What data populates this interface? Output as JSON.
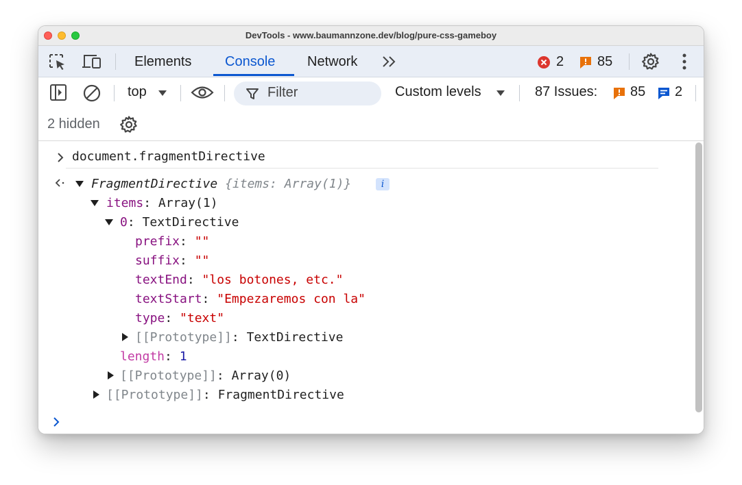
{
  "window": {
    "title": "DevTools - www.baumannzone.dev/blog/pure-css-gameboy"
  },
  "tabs": {
    "elements": "Elements",
    "console": "Console",
    "network": "Network"
  },
  "header_counts": {
    "errors": "2",
    "warnings": "85"
  },
  "toolbar": {
    "context": "top",
    "filter_placeholder": "Filter",
    "levels": "Custom levels",
    "issues_label": "87 Issues:",
    "issues_warnings": "85",
    "issues_info": "2",
    "hidden": "2 hidden"
  },
  "console": {
    "input": "document.fragmentDirective",
    "result": {
      "class": "FragmentDirective",
      "preview": "{items: Array(1)}",
      "info_badge": "i",
      "items_key": "items",
      "items_value": "Array(1)",
      "item0_key": "0",
      "item0_value": "TextDirective",
      "props": [
        {
          "key": "prefix",
          "value": "\"\""
        },
        {
          "key": "suffix",
          "value": "\"\""
        },
        {
          "key": "textEnd",
          "value": "\"los botones, etc.\""
        },
        {
          "key": "textStart",
          "value": "\"Empezaremos con la\""
        },
        {
          "key": "type",
          "value": "\"text\""
        }
      ],
      "proto_textdirective_key": "[[Prototype]]",
      "proto_textdirective_value": "TextDirective",
      "length_key": "length",
      "length_value": "1",
      "proto_array_key": "[[Prototype]]",
      "proto_array_value": "Array(0)",
      "proto_fragment_key": "[[Prototype]]",
      "proto_fragment_value": "FragmentDirective"
    }
  },
  "colors": {
    "accent": "#0b57d0",
    "error": "#dc362e",
    "warning": "#e8710a",
    "property_key": "#881280",
    "string_value": "#c80000",
    "number_value": "#1a1aa6"
  }
}
